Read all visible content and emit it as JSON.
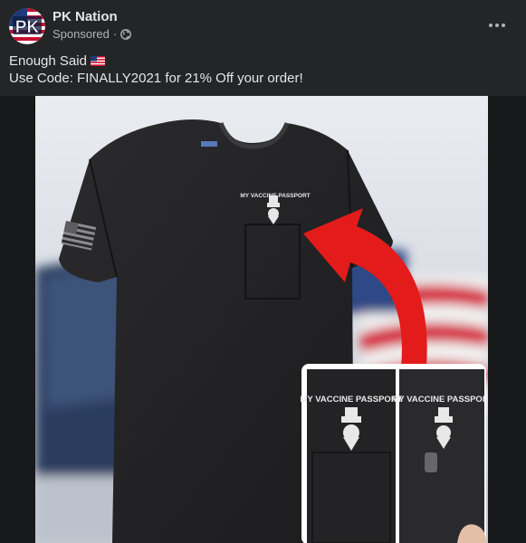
{
  "post": {
    "page_name": "PK Nation",
    "avatar_text": "PK",
    "sponsored_label": "Sponsored",
    "separator": "·",
    "caption_line1": "Enough Said",
    "caption_line2": "Use Code: FINALLY2021 for 21% Off your order!"
  },
  "image": {
    "shirt_print": "MY VACCINE PASSPORT",
    "inset_left_text": "MY VACCINE PASSPORT",
    "inset_right_text": "MY VACCINE PASSPORT"
  },
  "colors": {
    "background": "#242526",
    "primary_text": "#e4e6eb",
    "secondary_text": "#b0b3b8",
    "arrow": "#e31b1b"
  },
  "icons": {
    "audience": "globe-icon",
    "menu": "more-options-icon",
    "caption_emoji": "us-flag-icon"
  }
}
